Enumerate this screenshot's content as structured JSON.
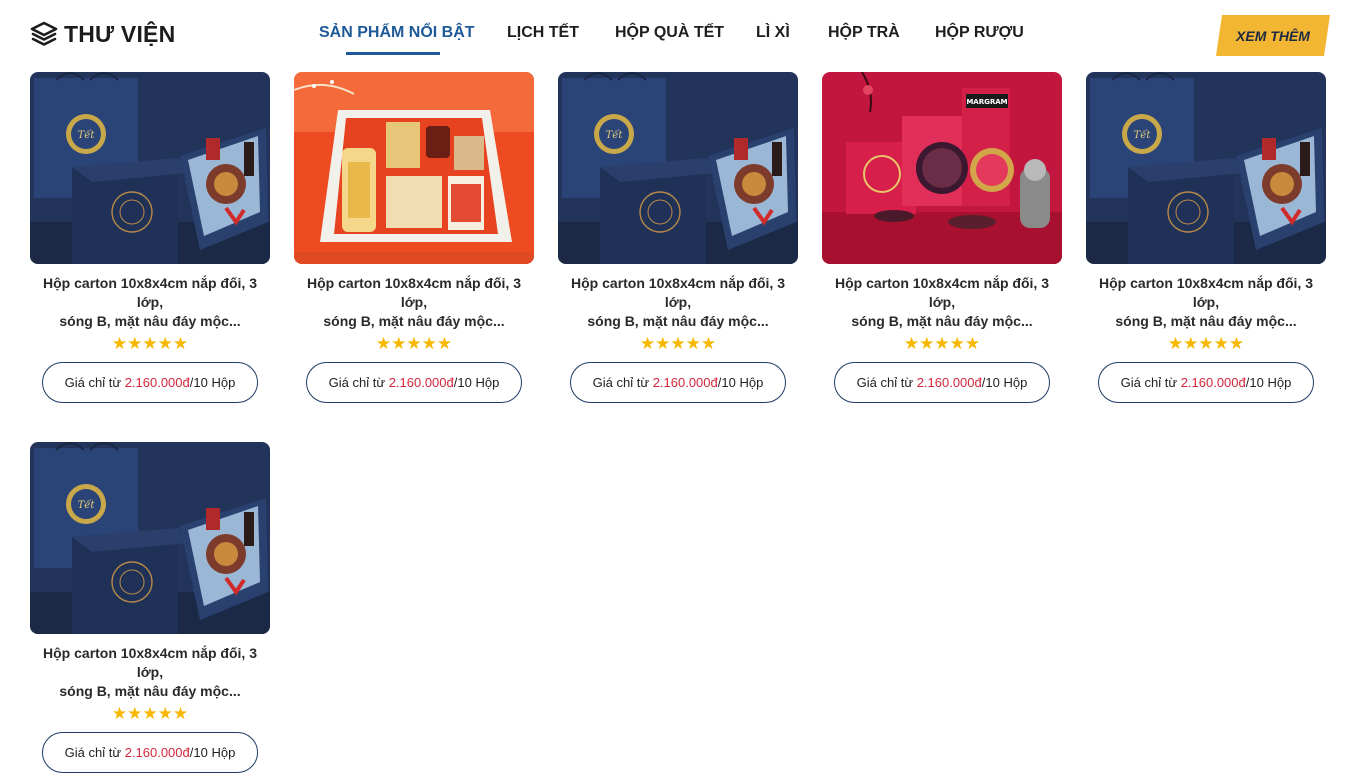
{
  "brand": {
    "name": "THƯ VIỆN",
    "icon": "layers-icon"
  },
  "nav": {
    "items": [
      {
        "label": "SẢN PHẨM NỔI BẬT",
        "active": true
      },
      {
        "label": "LỊCH TẾT",
        "active": false
      },
      {
        "label": "HỘP QUÀ TẾT",
        "active": false
      },
      {
        "label": "LÌ XÌ",
        "active": false
      },
      {
        "label": "HỘP TRÀ",
        "active": false
      },
      {
        "label": "HỘP RƯỢU",
        "active": false
      }
    ],
    "more_label": "XEM THÊM"
  },
  "colors": {
    "accent": "#1e5a98",
    "button_bg": "#f2b632",
    "price": "#d3273a",
    "star": "#f6b800",
    "pill_border": "#1d3c66"
  },
  "products": [
    {
      "image": "navy-gift-box",
      "title_line1": "Hộp carton 10x8x4cm nắp đối, 3 lớp,",
      "title_line2": "sóng B, mặt nâu đáy mộc...",
      "stars": "★★★★★",
      "rating": 5,
      "price_prefix": "Giá chỉ từ ",
      "price": "2.160.000đ",
      "price_suffix": "/10 Hộp"
    },
    {
      "image": "orange-ginseng-box",
      "title_line1": "Hộp carton 10x8x4cm nắp đối, 3 lớp,",
      "title_line2": "sóng B, mặt nâu đáy mộc...",
      "stars": "★★★★★",
      "rating": 5,
      "price_prefix": "Giá chỉ từ ",
      "price": "2.160.000đ",
      "price_suffix": "/10 Hộp"
    },
    {
      "image": "navy-gift-box",
      "title_line1": "Hộp carton 10x8x4cm nắp đối, 3 lớp,",
      "title_line2": "sóng B, mặt nâu đáy mộc...",
      "stars": "★★★★★",
      "rating": 5,
      "price_prefix": "Giá chỉ từ ",
      "price": "2.160.000đ",
      "price_suffix": "/10 Hộp"
    },
    {
      "image": "red-tea-set-box",
      "image_text": "MARGRAM",
      "title_line1": "Hộp carton 10x8x4cm nắp đối, 3 lớp,",
      "title_line2": "sóng B, mặt nâu đáy mộc...",
      "stars": "★★★★★",
      "rating": 5,
      "price_prefix": "Giá chỉ từ ",
      "price": "2.160.000đ",
      "price_suffix": "/10 Hộp"
    },
    {
      "image": "navy-gift-box",
      "title_line1": "Hộp carton 10x8x4cm nắp đối, 3 lớp,",
      "title_line2": "sóng B, mặt nâu đáy mộc...",
      "stars": "★★★★★",
      "rating": 5,
      "price_prefix": "Giá chỉ từ ",
      "price": "2.160.000đ",
      "price_suffix": "/10 Hộp"
    },
    {
      "image": "navy-gift-box",
      "title_line1": "Hộp carton 10x8x4cm nắp đối, 3 lớp,",
      "title_line2": "sóng B, mặt nâu đáy mộc...",
      "stars": "★★★★★",
      "rating": 5,
      "price_prefix": "Giá chỉ từ ",
      "price": "2.160.000đ",
      "price_suffix": "/10 Hộp"
    }
  ]
}
